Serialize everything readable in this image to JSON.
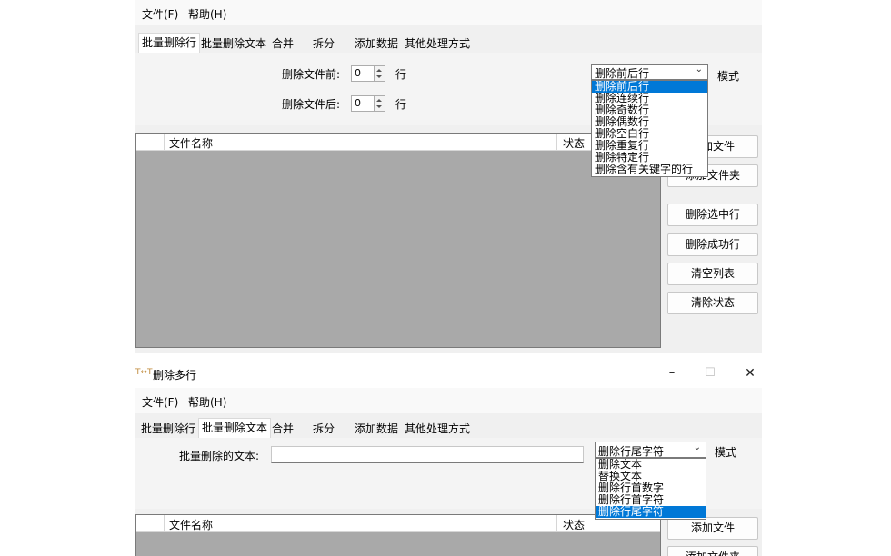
{
  "top_window": {
    "menu": [
      {
        "label": "文件(F)"
      },
      {
        "label": "帮助(H)"
      }
    ],
    "tabs": [
      "批量删除行",
      "批量删除文本",
      "合并",
      "拆分",
      "添加数据",
      "其他处理方式"
    ],
    "active_tab": "批量删除行",
    "delete_before_label": "删除文件前:",
    "delete_before_value": "0",
    "delete_before_unit": "行",
    "delete_after_label": "删除文件后:",
    "delete_after_value": "0",
    "delete_after_unit": "行",
    "mode_combo_value": "删除前后行",
    "mode_label": "模式",
    "mode_options": [
      "删除前后行",
      "删除连续行",
      "删除奇数行",
      "删除偶数行",
      "删除空白行",
      "删除重复行",
      "删除特定行",
      "删除含有关键字的行"
    ],
    "mode_selected_index": 0,
    "list_header_name": "文件名称",
    "list_header_status": "状态",
    "buttons": [
      "添加文件",
      "添加文件夹",
      "删除选中行",
      "删除成功行",
      "清空列表",
      "清除状态"
    ]
  },
  "bottom_window": {
    "title": "删除多行",
    "menu": [
      {
        "label": "文件(F)"
      },
      {
        "label": "帮助(H)"
      }
    ],
    "tabs": [
      "批量删除行",
      "批量删除文本",
      "合并",
      "拆分",
      "添加数据",
      "其他处理方式"
    ],
    "active_tab": "批量删除文本",
    "text_label": "批量删除的文本:",
    "text_value": "",
    "mode_combo_value": "删除行尾字符",
    "mode_label": "模式",
    "mode_options": [
      "删除文本",
      "替换文本",
      "删除行首数字",
      "删除行首字符",
      "删除行尾字符"
    ],
    "mode_selected_index": 4,
    "list_header_name": "文件名称",
    "list_header_status": "状态",
    "buttons": [
      "添加文件",
      "添加文件夹"
    ]
  },
  "colors": {
    "window_bg": "#f0f0f0",
    "list_bg": "#a9a9a9",
    "selection": "#0078d7"
  }
}
